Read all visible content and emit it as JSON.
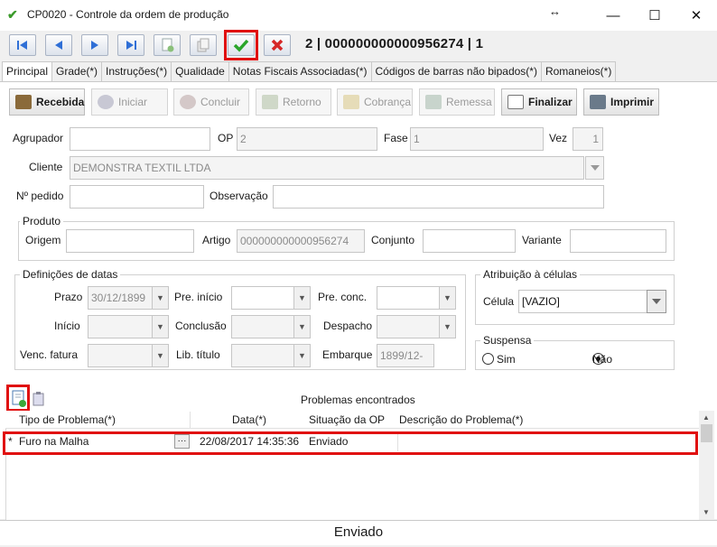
{
  "window": {
    "title": "CP0020 - Controle da ordem de produção",
    "minimize": "—",
    "maximize": "☐",
    "close": "✕",
    "resize_glyph": "↔"
  },
  "record": {
    "text": "2 | 000000000000956274 | 1"
  },
  "tabs": [
    "Principal",
    "Grade(*)",
    "Instruções(*)",
    "Qualidade",
    "Notas Fiscais Associadas(*)",
    "Códigos de barras não bipados(*)",
    "Romaneios(*)"
  ],
  "actions": {
    "recebida": "Recebida",
    "iniciar": "Iniciar",
    "concluir": "Concluir",
    "retorno": "Retorno",
    "cobranca": "Cobrança",
    "remessa": "Remessa",
    "finalizar": "Finalizar",
    "imprimir": "Imprimir"
  },
  "form": {
    "agrupador_label": "Agrupador",
    "agrupador_value": "",
    "op_label": "OP",
    "op_value": "2",
    "fase_label": "Fase",
    "fase_value": "1",
    "vez_label": "Vez",
    "vez_value": "1",
    "cliente_label": "Cliente",
    "cliente_value": "DEMONSTRA TEXTIL LTDA",
    "pedido_label": "Nº pedido",
    "pedido_value": "",
    "observacao_label": "Observação",
    "observacao_value": ""
  },
  "produto": {
    "title": "Produto",
    "origem_label": "Origem",
    "origem_value": "",
    "artigo_label": "Artigo",
    "artigo_value": "000000000000956274",
    "conjunto_label": "Conjunto",
    "conjunto_value": "",
    "variante_label": "Variante",
    "variante_value": ""
  },
  "datas": {
    "title": "Definições de datas",
    "prazo_label": "Prazo",
    "prazo_value": "30/12/1899",
    "pre_inicio_label": "Pre. início",
    "pre_conc_label": "Pre. conc.",
    "inicio_label": "Início",
    "conclusao_label": "Conclusão",
    "despacho_label": "Despacho",
    "venc_label": "Venc. fatura",
    "lib_label": "Lib. título",
    "embarque_label": "Embarque",
    "embarque_value": "1899/12-"
  },
  "celulas": {
    "title": "Atribuição à células",
    "celula_label": "Célula",
    "celula_value": "[VAZIO]"
  },
  "suspensa": {
    "title": "Suspensa",
    "sim": "Sim",
    "nao": "Não",
    "selected": "Não"
  },
  "problemas": {
    "title": "Problemas encontrados",
    "columns": [
      "Tipo de Problema(*)",
      "Data(*)",
      "Situação da OP",
      "Descrição do Problema(*)"
    ],
    "rows": [
      {
        "marker": "*",
        "tipo": "Furo na Malha",
        "ellipsis": "···",
        "data": "22/08/2017 14:35:36",
        "situacao": "Enviado",
        "descricao": ""
      }
    ]
  },
  "statusbar": {
    "text": "Enviado"
  },
  "colors": {
    "highlight": "#e01010",
    "confirm": "#2aa52a",
    "cancel": "#d62828",
    "nav_blue": "#2f6fd6"
  }
}
